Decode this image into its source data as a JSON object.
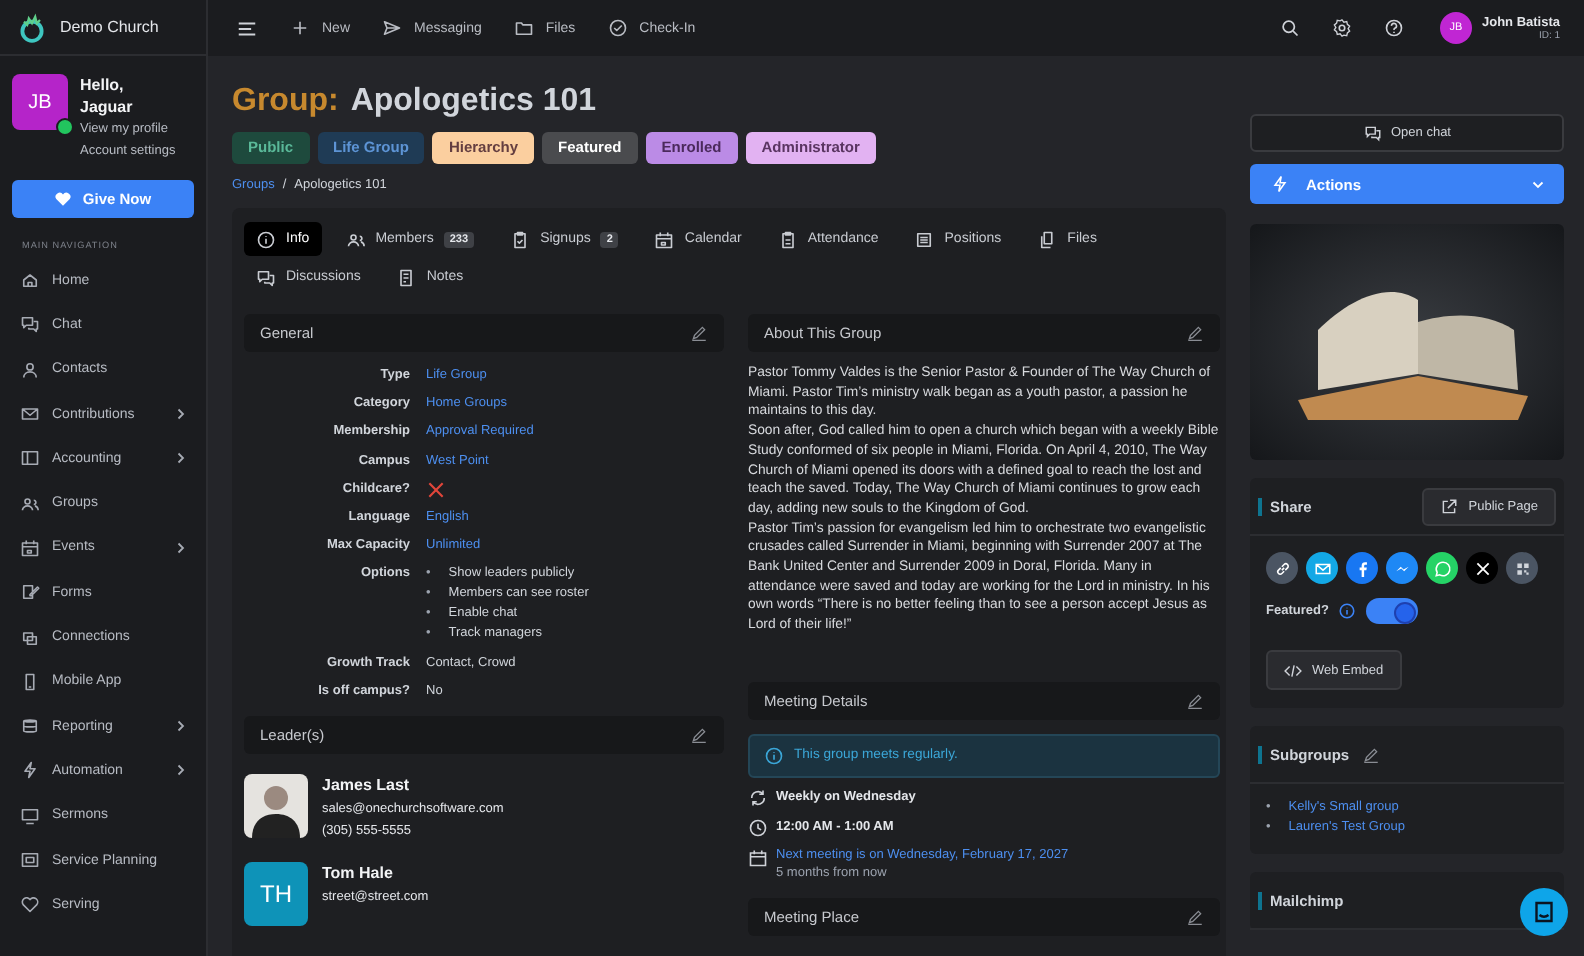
{
  "sidebar": {
    "brand": "Demo Church",
    "profile": {
      "initials": "JB",
      "greeting": "Hello,",
      "name": "Jaguar",
      "online": true,
      "links": [
        "View my profile",
        "Account settings"
      ]
    },
    "give_button": "Give Now",
    "section_label": "MAIN NAVIGATION",
    "items": [
      {
        "label": "Home",
        "has_submenu": false
      },
      {
        "label": "Chat",
        "has_submenu": false
      },
      {
        "label": "Contacts",
        "has_submenu": false
      },
      {
        "label": "Contributions",
        "has_submenu": true
      },
      {
        "label": "Accounting",
        "has_submenu": true
      },
      {
        "label": "Groups",
        "has_submenu": false
      },
      {
        "label": "Events",
        "has_submenu": true
      },
      {
        "label": "Forms",
        "has_submenu": false
      },
      {
        "label": "Connections",
        "has_submenu": false
      },
      {
        "label": "Mobile App",
        "has_submenu": false
      },
      {
        "label": "Reporting",
        "has_submenu": true
      },
      {
        "label": "Automation",
        "has_submenu": true
      },
      {
        "label": "Sermons",
        "has_submenu": false
      },
      {
        "label": "Service Planning",
        "has_submenu": false
      },
      {
        "label": "Serving",
        "has_submenu": false
      }
    ]
  },
  "topbar": {
    "actions": [
      "New",
      "Messaging",
      "Files",
      "Check-In"
    ],
    "user": {
      "initials": "JB",
      "name": "John Batista",
      "id": "ID: 1"
    }
  },
  "header": {
    "prefix": "Group:",
    "title": "Apologetics 101",
    "badges": [
      {
        "label": "Public",
        "color": "#1e4a3d"
      },
      {
        "label": "Life Group",
        "color": "#1f3b55"
      },
      {
        "label": "Hierarchy",
        "color": "#fbcf9f"
      },
      {
        "label": "Featured",
        "color": "#4a4b4e"
      },
      {
        "label": "Enrolled",
        "color": "#bb8be6"
      },
      {
        "label": "Administrator",
        "color": "#e2b2f2"
      }
    ],
    "breadcrumb": [
      "Groups",
      "Apologetics 101"
    ],
    "breadcrumb_separator": "/"
  },
  "tabs": [
    {
      "label": "Info",
      "selected": true
    },
    {
      "label": "Members",
      "count": "233",
      "selected": false
    },
    {
      "label": "Signups",
      "count": "2",
      "selected": false
    },
    {
      "label": "Calendar",
      "selected": false
    },
    {
      "label": "Attendance",
      "selected": false
    },
    {
      "label": "Positions",
      "selected": false
    },
    {
      "label": "Files",
      "selected": false
    },
    {
      "label": "Discussions",
      "selected": false
    },
    {
      "label": "Notes",
      "selected": false
    }
  ],
  "general": {
    "title": "General",
    "fields": [
      {
        "label": "Type",
        "kind": "link",
        "value": "Life Group"
      },
      {
        "label": "Category",
        "kind": "link",
        "value": "Home Groups"
      },
      {
        "label": "Membership",
        "kind": "link",
        "value": "Approval Required"
      },
      {
        "label": "Campus",
        "kind": "link",
        "value": "West Point"
      },
      {
        "label": "Childcare?",
        "kind": "boolean",
        "checked": false
      },
      {
        "label": "Language",
        "kind": "link",
        "value": "English"
      },
      {
        "label": "Max Capacity",
        "kind": "link",
        "value": "Unlimited"
      },
      {
        "label": "Options",
        "kind": "list",
        "marker": "•",
        "values": [
          "Show leaders publicly",
          "Members can see roster",
          "Enable chat",
          "Track managers"
        ]
      },
      {
        "label": "Growth Track",
        "kind": "text",
        "value": "Contact, Crowd"
      },
      {
        "label": "Is off campus?",
        "kind": "text",
        "value": "No"
      }
    ]
  },
  "leaders": {
    "title": "Leader(s)",
    "people": [
      {
        "kind": "photo",
        "name": "James Last",
        "email": "sales@onechurchsoftware.com",
        "phone": "(305) 555-5555"
      },
      {
        "kind": "initials",
        "initials": "TH",
        "name": "Tom Hale",
        "email": "street@street.com"
      }
    ]
  },
  "about": {
    "title": "About This Group",
    "paragraphs": [
      "Pastor Tommy Valdes is the Senior Pastor & Founder of The Way Church of Miami. Pastor Tim’s ministry walk began as a youth pastor, a passion he maintains to this day.",
      "Soon after, God called him to open a church which began with a weekly Bible Study conformed of six people in Miami, Florida. On April 4, 2010, The Way Church of Miami opened its doors with a defined goal to reach the lost and teach the saved. Today, The Way Church of Miami continues to grow each day, adding new souls to the Kingdom of God.",
      "Pastor Tim’s passion for evangelism led him to orchestrate two evangelistic crusades called Surrender in Miami, beginning with Surrender 2007 at The Bank United Center and Surrender 2009 in Doral, Florida. Many in attendance were saved and today are working for the Lord in ministry. In his own words “There is no better feeling than to see a person accept Jesus as Lord of their life!”"
    ]
  },
  "meeting": {
    "title": "Meeting Details",
    "notice": "This group meets regularly.",
    "schedule": "Weekly on Wednesday",
    "time": "12:00 AM - 1:00 AM",
    "next": "Next meeting is on Wednesday, February 17, 2027",
    "relative": "5 months from now"
  },
  "meeting_place": {
    "title": "Meeting Place"
  },
  "aside": {
    "open_chat": "Open chat",
    "actions": "Actions",
    "share": {
      "title": "Share",
      "public_page": "Public Page",
      "featured_label": "Featured?",
      "featured": true,
      "web_embed": "Web Embed"
    },
    "subgroups": {
      "title": "Subgroups",
      "marker": "•",
      "items": [
        "Kelly's Small group",
        "Lauren's Test Group"
      ]
    },
    "mailchimp": {
      "title": "Mailchimp"
    }
  }
}
